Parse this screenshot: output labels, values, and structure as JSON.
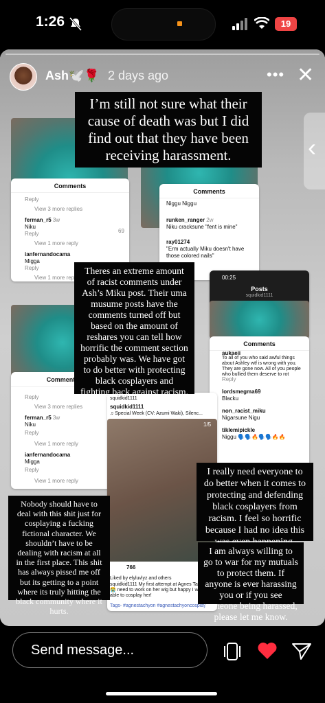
{
  "status": {
    "time": "1:26",
    "battery": "19"
  },
  "header": {
    "username": "Ash🕊️🌹",
    "posted": "2 days ago"
  },
  "text_boxes": {
    "box1": "I’m still not sure what their cause of death was but I did find out that they have been receiving harassment.",
    "box2": "Theres an extreme amount of racist comments under Ash’s Miku post. Their uma musume posts have the comments turned off but based on the amount of reshares you can tell how horrific the comment section probably was. We have got to do better with protecting black cosplayers and fighting back against racism.",
    "box3": "Nobody should have to deal with this shit just for cosplaying a fucking fictional character. We shouldn’t have to be dealing with racism at all in the first place. This shit has always pissed me off but its getting to a point where its truly hitting the black community where it hurts.",
    "box4": "I really need everyone to do better when it comes to protecting and defending black cosplayers from racism. I feel so horrific because I had no idea this was even happening.",
    "box5": "I am always willing to go to war for my mutuals to protect them. If anyone is ever harassing you or if you see someone being harassed, please let me know."
  },
  "cards": {
    "comments_title": "Comments",
    "reply": "Reply",
    "view3": "View 3 more replies",
    "view1": "View 1 more reply",
    "user_ferman": "ferman_r5",
    "user_ferman_time": "3w",
    "comment_niku": "Niku",
    "likes_69": "69",
    "user_ianfer": "ianfernandocama",
    "comment_migga": "Migga",
    "niggu": "Niggu Niggu",
    "runken": "runken_ranger",
    "runken_time": "2w",
    "runken_text": "Niku cracksune \"fent is mine\"",
    "ray": "ray01274",
    "ray_text": "\"Erm actually Miku doesn't have those colored nails\"",
    "posts_title": "Posts",
    "posts_user": "squidkid1111",
    "posts_time": "00:25",
    "aukaei": "aukaeii",
    "aukaei_text": "To all of you who said awful things about Ashley wtf is wrong with you. They are gone now. All of you people who bullied them deserve to rot",
    "lords": "lordsmegma69",
    "lords_text": "Blacku",
    "nonracist": "non_racist_miku",
    "nonracist_text": "Nigarsune Nigu",
    "tiklemi": "tiklemipickle",
    "tiklemi_text": "Niggu 🗣️🗣️🔥🗣️🗣️🔥🔥",
    "post_user": "squidkid1111",
    "post_song": "♫ Special Week (CV: Azumi Waki), Silenc...",
    "post_count": "1/5",
    "post_likes": "766",
    "liked_by": "Liked by elyluvlyz and others",
    "caption": "squidkid1111 My first attempt at Agnes Tachyon 😭 need to work on her wig but happy I was able to cosplay her!",
    "tags": "Tags- #agnestachyon #agnestachyoncosplay"
  },
  "bottom": {
    "placeholder": "Send message..."
  }
}
